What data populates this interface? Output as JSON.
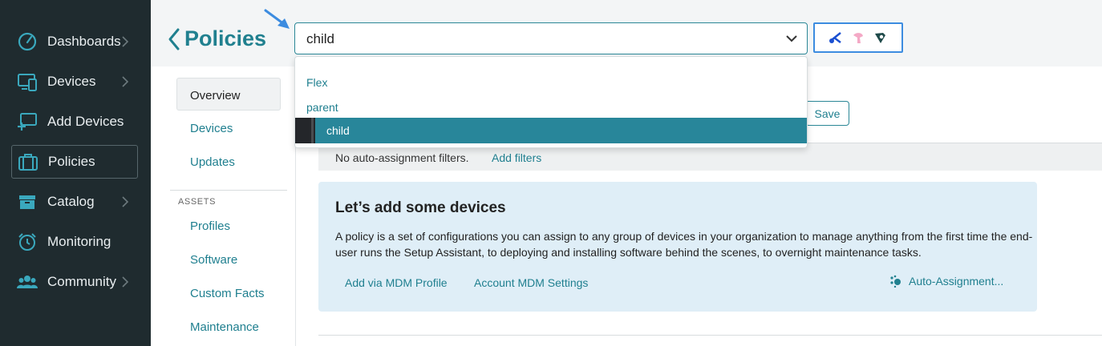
{
  "sidebar": {
    "items": [
      {
        "label": "Dashboards",
        "icon": "gauge-icon",
        "has_chevron": true
      },
      {
        "label": "Devices",
        "icon": "devices-icon",
        "has_chevron": true
      },
      {
        "label": "Add Devices",
        "icon": "add-device-icon",
        "has_chevron": false
      },
      {
        "label": "Policies",
        "icon": "briefcase-icon",
        "has_chevron": false,
        "active": true
      },
      {
        "label": "Catalog",
        "icon": "box-icon",
        "has_chevron": true
      },
      {
        "label": "Monitoring",
        "icon": "alarm-clock-icon",
        "has_chevron": false
      },
      {
        "label": "Community",
        "icon": "people-icon",
        "has_chevron": true
      }
    ]
  },
  "header": {
    "title": "Policies",
    "selector": {
      "value": "child",
      "options": [
        "Flex",
        "parent",
        "child"
      ]
    },
    "tools": [
      "scissors-icon",
      "pink-tool-icon",
      "brush-icon"
    ]
  },
  "subnav": {
    "items": [
      "Overview",
      "Devices",
      "Updates"
    ],
    "section_label": "ASSETS",
    "asset_items": [
      "Profiles",
      "Software",
      "Custom Facts",
      "Maintenance"
    ]
  },
  "main": {
    "save_label": "Save",
    "filter_text": "No auto-assignment filters.",
    "filter_link": "Add filters",
    "card": {
      "title": "Let’s add some devices",
      "description": "A policy is a set of configurations you can assign to any group of devices in your organization to manage anything from the first time the end-user runs the Setup Assistant, to deploying and installing software behind the scenes, to overnight maintenance tasks.",
      "action_1": "Add via MDM Profile",
      "action_2": "Account MDM Settings",
      "action_3": "Auto-Assignment..."
    }
  },
  "colors": {
    "sidebar_bg": "#1f2b2f",
    "accent": "#20808f",
    "selected_option": "#28869a",
    "card_bg": "#dfeef7",
    "highlight_border": "#3c8ce0"
  }
}
